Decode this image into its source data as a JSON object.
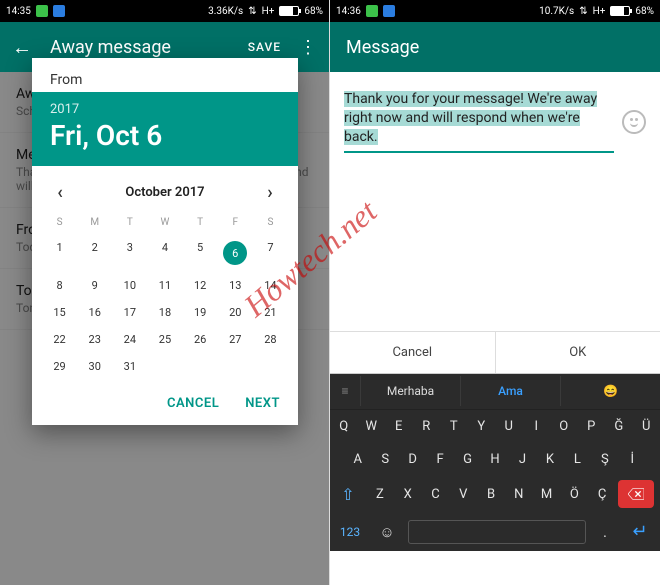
{
  "left": {
    "status": {
      "time": "14:35",
      "net": "3.36K/s",
      "netType": "H+",
      "battery": "68%",
      "batteryFill": 68
    },
    "appbar": {
      "title": "Away message",
      "save": "SAVE"
    },
    "bg": [
      {
        "h": "Away message",
        "s": "Schedule"
      },
      {
        "h": "Message",
        "s": "Thank you for your message! We're away right now and will respond..."
      },
      {
        "h": "From",
        "s": "Today"
      },
      {
        "h": "To",
        "s": "Tomorrow"
      }
    ],
    "dialog": {
      "fromLabel": "From",
      "year": "2017",
      "dateLine": "Fri, Oct 6",
      "monthLabel": "October 2017",
      "dow": [
        "S",
        "M",
        "T",
        "W",
        "T",
        "F",
        "S"
      ],
      "selectedDay": 6,
      "daysInMonth": 31,
      "cancel": "CANCEL",
      "next": "NEXT"
    }
  },
  "right": {
    "status": {
      "time": "14:36",
      "net": "10.7K/s",
      "netType": "H+",
      "battery": "68%",
      "batteryFill": 68
    },
    "appbar": {
      "title": "Message"
    },
    "messageText": "Thank you for your message! We're away right now and will respond when we're back.",
    "actions": {
      "cancel": "Cancel",
      "ok": "OK"
    },
    "keyboard": {
      "suggestions": [
        "Merhaba",
        "Ama",
        "😄"
      ],
      "row1": [
        "Q",
        "W",
        "E",
        "R",
        "T",
        "Y",
        "U",
        "I",
        "O",
        "P",
        "Ğ",
        "Ü"
      ],
      "row2": [
        "A",
        "S",
        "D",
        "F",
        "G",
        "H",
        "J",
        "K",
        "L",
        "Ş",
        "İ"
      ],
      "row3": [
        "Z",
        "X",
        "C",
        "V",
        "B",
        "N",
        "M",
        "Ö",
        "Ç"
      ],
      "numKey": "123",
      "dotKey": "."
    }
  },
  "watermark": "Howtech.net"
}
